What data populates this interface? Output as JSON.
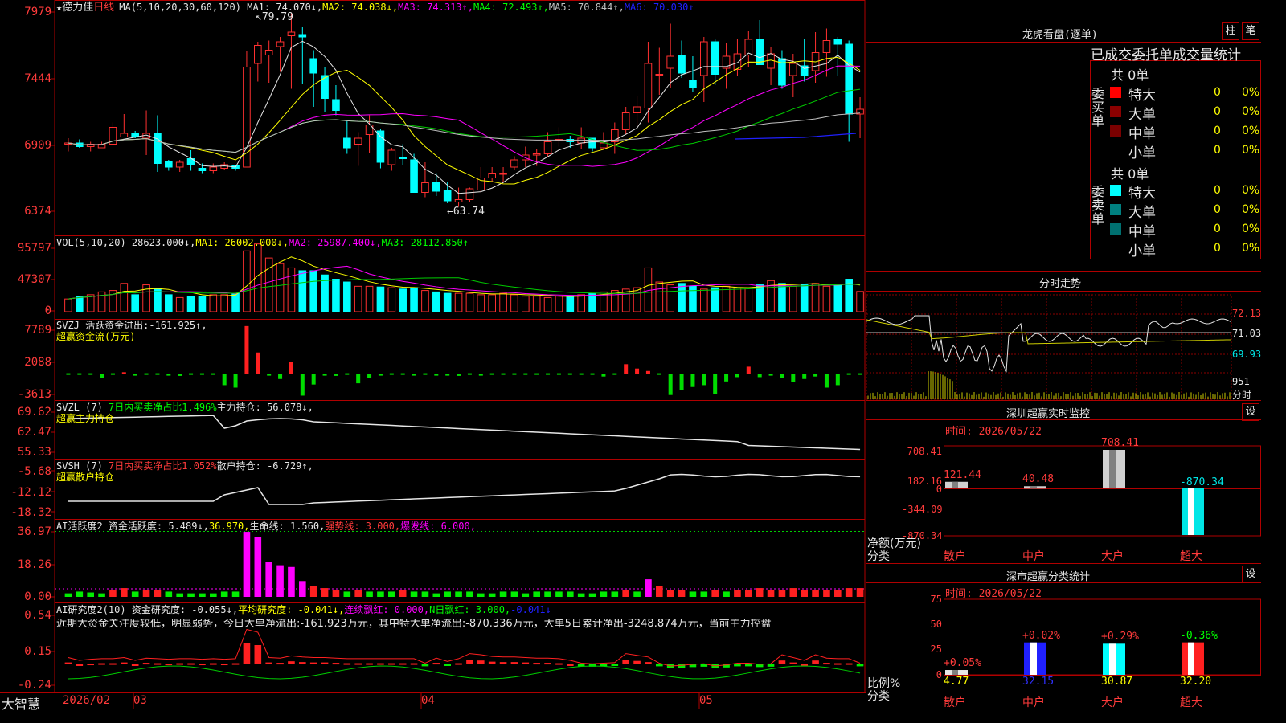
{
  "stock": {
    "star": "★",
    "name": "德力佳",
    "period": "日线"
  },
  "kline": {
    "ma_header": [
      {
        "label": "MA(5,10,20,30,60,120)",
        "value": "",
        "color": "#e6e6e6"
      },
      {
        "label": "MA1:",
        "value": "74.070↓,",
        "color": "#e6e6e6"
      },
      {
        "label": "MA2:",
        "value": "74.038↓,",
        "color": "#ffff00"
      },
      {
        "label": "MA3:",
        "value": "74.313↑,",
        "color": "#ff00ff"
      },
      {
        "label": "MA4:",
        "value": "72.493↑,",
        "color": "#00ff00"
      },
      {
        "label": "MA5:",
        "value": "70.844↑,",
        "color": "#c0c0c0"
      },
      {
        "label": "MA6:",
        "value": "70.030↑",
        "color": "#2020ff"
      }
    ],
    "yticks": [
      "7979",
      "7444",
      "6909",
      "6374"
    ],
    "high_label": "79.79",
    "low_label": "63.74"
  },
  "vol": {
    "header": [
      {
        "label": "VOL(5,10,20)",
        "value": "28623.000↓,",
        "color": "#e6e6e6"
      },
      {
        "label": "MA1:",
        "value": "26002.000↓,",
        "color": "#ffff00"
      },
      {
        "label": "MA2:",
        "value": "25987.400↓,",
        "color": "#ff00ff"
      },
      {
        "label": "MA3:",
        "value": "28112.850↑",
        "color": "#00ff00"
      }
    ],
    "yticks": [
      "95797",
      "47307",
      "0"
    ]
  },
  "svzj": {
    "header": [
      {
        "label": "SVZJ",
        "value": "活跃资金进出:",
        "color": "#e6e6e6"
      },
      {
        "label": "",
        "value": "-161.925↑,",
        "color": "#e6e6e6"
      }
    ],
    "sub": "超赢资金流(万元)",
    "yticks": [
      "7789",
      "2088",
      "-3613"
    ]
  },
  "svzl": {
    "header": [
      {
        "label": "SVZL (7)",
        "value": "7日内买卖净占比1.496%",
        "color": "#00ff00"
      },
      {
        "label": "主力持仓:",
        "value": "56.078↓,",
        "color": "#e6e6e6"
      }
    ],
    "sub": "超赢主力持仓",
    "yticks": [
      "69.62",
      "62.47",
      "55.33"
    ]
  },
  "svsh": {
    "header": [
      {
        "label": "SVSH (7)",
        "value": "7日内买卖净占比1.052%",
        "color": "#ff3b3b"
      },
      {
        "label": "散户持仓:",
        "value": "-6.729↑,",
        "color": "#e6e6e6"
      }
    ],
    "sub": "超赢散户持仓",
    "yticks": [
      "-5.68",
      "-12.12",
      "-18.32"
    ]
  },
  "ai_active": {
    "header": [
      {
        "label": "AI活跃度2",
        "value": "资金活跃度: 5.489↓,",
        "color": "#e6e6e6"
      },
      {
        "label": "",
        "value": "36.970,",
        "color": "#ffff00"
      },
      {
        "label": "",
        "value": "生命线: 1.560,",
        "color": "#e6e6e6"
      },
      {
        "label": "",
        "value": "强势线: 3.000,",
        "color": "#ff3b3b"
      },
      {
        "label": "",
        "value": "爆发线: 6.000,",
        "color": "#ff00ff"
      }
    ],
    "yticks": [
      "36.97",
      "18.26",
      "0.00"
    ]
  },
  "ai_research": {
    "header": [
      {
        "label": "AI研究度2(10)",
        "value": "资金研究度: -0.055↓,",
        "color": "#e6e6e6"
      },
      {
        "label": "",
        "value": "平均研究度: -0.041↓,",
        "color": "#ffff00"
      },
      {
        "label": "",
        "value": "连续飘红: 0.000,",
        "color": "#ff00ff"
      },
      {
        "label": "",
        "value": "N日飘红: 3.000,",
        "color": "#00ff00"
      },
      {
        "label": "",
        "value": "-0.041↓",
        "color": "#2020ff"
      }
    ],
    "comment": "近期大资金关注度较低，明显弱势，今日大单净流出:-161.923万元，其中特大单净流出:-870.336万元，大单5日累计净出-3248.874万元，当前主力控盘",
    "yticks": [
      "0.54",
      "0.15",
      "-0.24"
    ]
  },
  "xaxis": {
    "brand": "大智慧",
    "labels": [
      "2026/02",
      "03",
      "04",
      "05"
    ]
  },
  "chart_data": {
    "type": "candlestick",
    "candles_ohlc": [
      [
        68.9,
        69.4,
        68.3,
        69.0
      ],
      [
        69.0,
        69.3,
        68.6,
        68.7
      ],
      [
        68.7,
        69.1,
        68.3,
        68.9
      ],
      [
        68.6,
        69.1,
        68.6,
        68.9
      ],
      [
        68.9,
        70.7,
        68.8,
        70.3
      ],
      [
        69.5,
        71.4,
        69.5,
        69.8
      ],
      [
        69.8,
        70.0,
        69.4,
        69.5
      ],
      [
        69.4,
        71.7,
        68.0,
        69.8
      ],
      [
        69.8,
        71.3,
        66.6,
        67.3
      ],
      [
        67.5,
        67.6,
        66.7,
        67.0
      ],
      [
        67.0,
        67.6,
        66.6,
        67.4
      ],
      [
        67.7,
        68.4,
        66.7,
        67.2
      ],
      [
        66.9,
        67.3,
        66.5,
        66.7
      ],
      [
        66.7,
        67.3,
        66.5,
        67.0
      ],
      [
        66.9,
        67.4,
        66.8,
        67.2
      ],
      [
        67.1,
        67.2,
        66.7,
        66.9
      ],
      [
        67.0,
        76.6,
        67.0,
        75.3
      ],
      [
        75.6,
        77.4,
        74.1,
        77.1
      ],
      [
        76.3,
        77.5,
        74.0,
        76.7
      ],
      [
        77.0,
        77.8,
        74.9,
        77.4
      ],
      [
        77.9,
        79.8,
        73.5,
        78.2
      ],
      [
        78.0,
        78.6,
        73.9,
        77.8
      ],
      [
        76.0,
        76.7,
        72.0,
        74.8
      ],
      [
        74.6,
        75.3,
        71.6,
        72.7
      ],
      [
        72.6,
        73.8,
        71.3,
        71.7
      ],
      [
        69.4,
        70.8,
        68.1,
        68.6
      ],
      [
        68.9,
        69.9,
        67.1,
        69.4
      ],
      [
        69.7,
        71.3,
        68.2,
        70.5
      ],
      [
        70.0,
        70.2,
        66.9,
        67.4
      ],
      [
        67.2,
        68.6,
        66.7,
        68.4
      ],
      [
        67.8,
        68.9,
        67.2,
        67.7
      ],
      [
        67.6,
        68.1,
        64.9,
        64.9
      ],
      [
        64.9,
        67.4,
        64.5,
        65.7
      ],
      [
        65.7,
        66.5,
        64.6,
        65.0
      ],
      [
        65.1,
        65.8,
        64.0,
        64.2
      ],
      [
        64.1,
        65.3,
        63.7,
        64.3
      ],
      [
        64.3,
        65.3,
        64.1,
        65.2
      ],
      [
        65.1,
        67.0,
        64.9,
        66.1
      ],
      [
        66.1,
        67.0,
        65.8,
        66.5
      ],
      [
        66.4,
        67.0,
        65.7,
        66.5
      ],
      [
        67.0,
        67.9,
        66.8,
        67.6
      ],
      [
        67.6,
        68.7,
        67.0,
        68.0
      ],
      [
        68.0,
        68.5,
        67.1,
        68.1
      ],
      [
        68.1,
        69.9,
        67.9,
        69.1
      ],
      [
        69.2,
        70.3,
        68.7,
        69.3
      ],
      [
        69.3,
        69.6,
        68.6,
        69.1
      ],
      [
        69.0,
        70.3,
        68.5,
        69.4
      ],
      [
        69.4,
        69.4,
        68.3,
        68.6
      ],
      [
        68.6,
        69.9,
        68.5,
        69.0
      ],
      [
        69.1,
        70.7,
        68.1,
        70.1
      ],
      [
        70.1,
        72.0,
        69.7,
        71.5
      ],
      [
        71.5,
        72.9,
        70.4,
        72.0
      ],
      [
        71.9,
        77.4,
        70.7,
        75.6
      ],
      [
        74.7,
        76.9,
        73.0,
        74.7
      ],
      [
        75.2,
        78.9,
        73.6,
        76.2
      ],
      [
        76.3,
        77.5,
        74.4,
        74.8
      ],
      [
        74.2,
        76.2,
        73.2,
        73.6
      ],
      [
        74.6,
        77.8,
        72.4,
        77.4
      ],
      [
        77.4,
        77.6,
        73.8,
        74.7
      ],
      [
        75.2,
        77.3,
        73.5,
        76.2
      ],
      [
        75.1,
        77.6,
        74.6,
        76.4
      ],
      [
        76.3,
        78.3,
        75.3,
        77.6
      ],
      [
        77.6,
        79.2,
        75.7,
        75.5
      ],
      [
        75.2,
        77.0,
        73.8,
        76.4
      ],
      [
        76.0,
        76.7,
        73.5,
        73.8
      ],
      [
        74.6,
        76.4,
        72.8,
        75.6
      ],
      [
        75.4,
        77.6,
        74.1,
        74.6
      ],
      [
        75.0,
        78.2,
        74.0,
        76.5
      ],
      [
        76.5,
        78.5,
        74.5,
        77.5
      ],
      [
        77.6,
        77.8,
        74.6,
        77.2
      ],
      [
        77.2,
        77.5,
        69.1,
        71.4
      ],
      [
        71.4,
        72.8,
        69.4,
        71.8
      ]
    ],
    "vol_values": [
      18000,
      22000,
      24000,
      28000,
      30000,
      40000,
      24000,
      38000,
      32000,
      24000,
      20000,
      22000,
      22000,
      24000,
      24000,
      26000,
      86000,
      95797,
      76000,
      68000,
      62000,
      58000,
      58000,
      52000,
      46000,
      42000,
      36000,
      36000,
      35000,
      34000,
      32000,
      34000,
      30000,
      28000,
      26000,
      26000,
      26000,
      24000,
      24000,
      26000,
      24000,
      22000,
      22000,
      20000,
      22000,
      22000,
      24000,
      26000,
      28000,
      30000,
      32000,
      34000,
      62000,
      42000,
      38000,
      40000,
      36000,
      32000,
      34000,
      36000,
      34000,
      34000,
      38000,
      44000,
      40000,
      36000,
      38000,
      40000,
      36000,
      38000,
      46000,
      28623
    ],
    "svzj_values": [
      0,
      0,
      0,
      -600,
      0,
      300,
      -200,
      0,
      0,
      -200,
      -300,
      0,
      0,
      0,
      -1800,
      -2200,
      7789,
      3500,
      -200,
      -800,
      2000,
      -3500,
      -1700,
      -200,
      -300,
      0,
      -1500,
      -600,
      -100,
      0,
      0,
      -200,
      0,
      -100,
      -200,
      -300,
      0,
      -200,
      0,
      0,
      0,
      0,
      0,
      0,
      0,
      0,
      0,
      0,
      -400,
      0,
      1600,
      900,
      500,
      0,
      -3400,
      -2600,
      -2100,
      -1800,
      -3200,
      -1200,
      -500,
      1200,
      -500,
      -200,
      -700,
      -1300,
      -800,
      -400,
      -2200,
      -1800,
      0,
      0,
      -2600,
      -162
    ]
  }
}
